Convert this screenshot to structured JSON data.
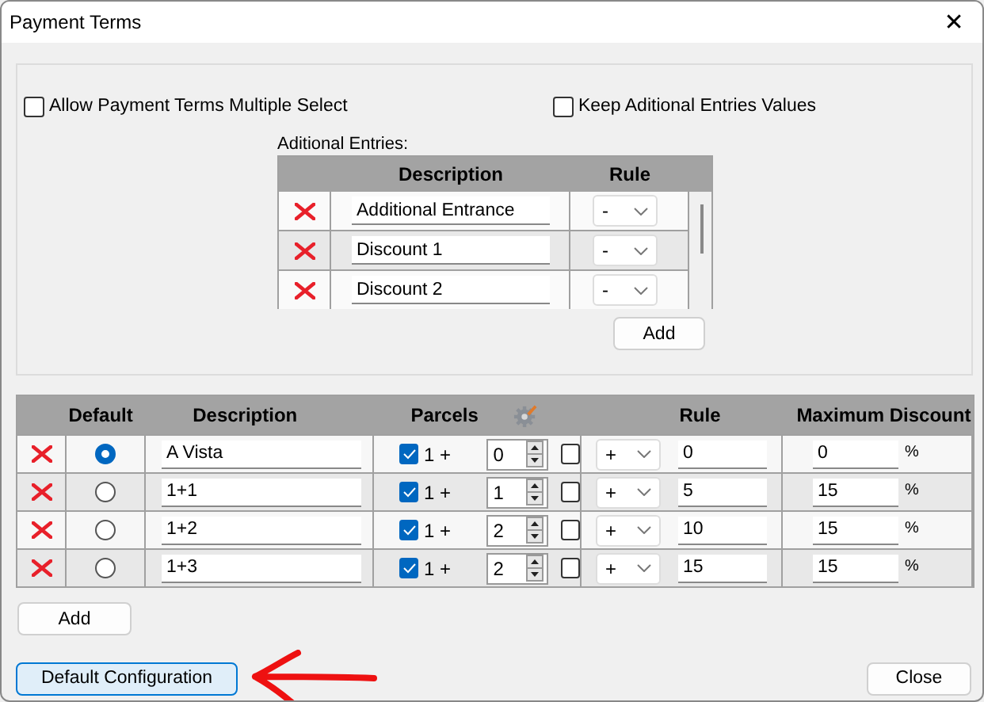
{
  "window": {
    "title": "Payment Terms",
    "close": "✕"
  },
  "options": [
    {
      "label": "Allow Payment Terms Multiple Select",
      "checked": false
    },
    {
      "label": "Keep Aditional Entries Values",
      "checked": false
    }
  ],
  "additional_entries": {
    "label": "Aditional Entries:",
    "columns": [
      "Description",
      "Rule"
    ],
    "rows": [
      {
        "description": "Additional Entrance",
        "rule": "-"
      },
      {
        "description": "Discount 1",
        "rule": "-"
      },
      {
        "description": "Discount 2",
        "rule": "-"
      }
    ],
    "add_button": "Add"
  },
  "terms": {
    "columns": [
      "Default",
      "Description",
      "Parcels",
      "Rule",
      "Maximum Discount"
    ],
    "rows": [
      {
        "selected": true,
        "description": "A Vista",
        "parcels_checked": true,
        "parcels_prefix": "1 +",
        "parcels": "0",
        "flag_checked": false,
        "rule_sign": "+",
        "rule_value": "0",
        "max_discount": "0",
        "unit": "%"
      },
      {
        "selected": false,
        "description": "1+1",
        "parcels_checked": true,
        "parcels_prefix": "1 +",
        "parcels": "1",
        "flag_checked": false,
        "rule_sign": "+",
        "rule_value": "5",
        "max_discount": "15",
        "unit": "%"
      },
      {
        "selected": false,
        "description": "1+2",
        "parcels_checked": true,
        "parcels_prefix": "1 +",
        "parcels": "2",
        "flag_checked": false,
        "rule_sign": "+",
        "rule_value": "10",
        "max_discount": "15",
        "unit": "%"
      },
      {
        "selected": false,
        "description": "1+3",
        "parcels_checked": true,
        "parcels_prefix": "1 +",
        "parcels": "2",
        "flag_checked": false,
        "rule_sign": "+",
        "rule_value": "15",
        "max_discount": "15",
        "unit": "%"
      }
    ],
    "add_button": "Add"
  },
  "footer": {
    "default_button": "Default Configuration",
    "close_button": "Close"
  }
}
